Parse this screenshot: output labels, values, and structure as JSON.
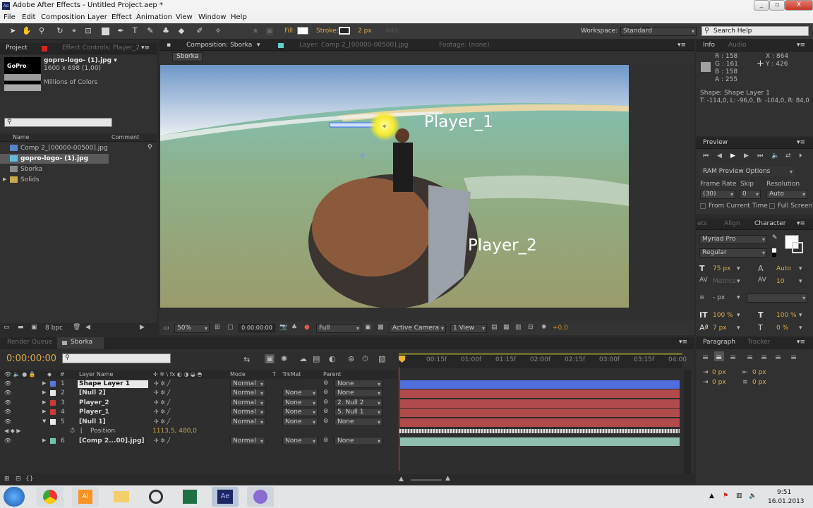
{
  "app": {
    "title": "Adobe After Effects - Untitled Project.aep *",
    "window_buttons": [
      "_",
      "▫",
      "X"
    ]
  },
  "menu": [
    "File",
    "Edit",
    "Composition",
    "Layer",
    "Effect",
    "Animation",
    "View",
    "Window",
    "Help"
  ],
  "toolbar": {
    "fill_label": "Fill:",
    "stroke_label": "Stroke:",
    "stroke_width": "2 px",
    "add_label": "Add:",
    "workspace_label": "Workspace:",
    "workspace_value": "Standard",
    "search_placeholder": "Search Help"
  },
  "project": {
    "tab": "Project",
    "tab2": "Effect Controls: Player_2",
    "file_name": "gopro-logo- (1).jpg ▾",
    "file_dims": "1600 x 698 (1,00)",
    "file_colors": "Millions of Colors",
    "col_name": "Name",
    "col_comment": "Comment",
    "items": [
      "Comp 2_[00000-00500].jpg",
      "gopro-logo- (1).jpg",
      "Sborka",
      "Solids"
    ],
    "bpc": "8 bpc"
  },
  "comp": {
    "tab": "Composition: Sborka",
    "tab_layer": "Layer: Comp 2_[00000-00500].jpg",
    "tab_footage": "Footage: (none)",
    "breadcrumb": "Sborka",
    "text1": "Player_1",
    "text2": "Player_2",
    "zoom": "50%",
    "timecode": "0:00:00:00",
    "quality": "Full",
    "camera": "Active Camera",
    "view": "1 View",
    "exposure": "+0,0"
  },
  "info": {
    "tab": "Info",
    "tab2": "Audio",
    "r": "R : 158",
    "g": "G : 161",
    "b": "B : 158",
    "a": "A : 255",
    "x": "X : 864",
    "y": "Y : 426",
    "shape": "Shape: Shape Layer 1",
    "bounds": "T: -114,0, L: -96,0, B: -104,0, R: 84,0"
  },
  "preview": {
    "tab": "Preview",
    "ram": "RAM Preview Options",
    "frame_rate_label": "Frame Rate",
    "skip_label": "Skip",
    "resolution_label": "Resolution",
    "frame_rate": "(30)",
    "skip": "0",
    "resolution": "Auto",
    "from_current": "From Current Time",
    "full_screen": "Full Screen"
  },
  "character": {
    "tab_effects": "ets",
    "tab_align": "Align",
    "tab_char": "Character",
    "font": "Myriad Pro",
    "style": "Regular",
    "size": "75 px",
    "leading": "Auto",
    "kerning": "Metrics",
    "tracking": "10",
    "indent_unit": "- px",
    "v_scale": "100 %",
    "h_scale": "100 %",
    "baseline": "7 px",
    "tsume": "0 %"
  },
  "paragraph": {
    "tab": "Paragraph",
    "tab2": "Tracker",
    "v1": "0 px",
    "v2": "0 px",
    "v3": "0 px",
    "v4": "0 px",
    "v5": "0 px"
  },
  "timeline": {
    "tab_render": "Render Queue",
    "tab_comp": "Sborka",
    "timecode": "0:00:00:00",
    "col_layer": "Layer Name",
    "col_mode": "Mode",
    "col_t": "T",
    "col_trkmat": "TrkMat",
    "col_parent": "Parent",
    "ruler": [
      "0f",
      "00:15f",
      "01:00f",
      "01:15f",
      "02:00f",
      "02:15f",
      "03:00f",
      "03:15f",
      "04:00"
    ],
    "layers": [
      {
        "num": "1",
        "name": "Shape Layer 1",
        "mode": "Normal",
        "trkmat": "",
        "parent": "None",
        "color": "#5b74d6"
      },
      {
        "num": "2",
        "name": "[Null 2]",
        "mode": "Normal",
        "trkmat": "None",
        "parent": "None",
        "color": "#e8e8e8"
      },
      {
        "num": "3",
        "name": "Player_2",
        "mode": "Normal",
        "trkmat": "None",
        "parent": "2. Null 2",
        "color": "#c93b3b"
      },
      {
        "num": "4",
        "name": "Player_1",
        "mode": "Normal",
        "trkmat": "None",
        "parent": "5. Null 1",
        "color": "#c93b3b"
      },
      {
        "num": "5",
        "name": "[Null 1]",
        "mode": "Normal",
        "trkmat": "None",
        "parent": "None",
        "color": "#e8e8e8"
      },
      {
        "num": "6",
        "name": "[Comp 2...00].jpg]",
        "mode": "Normal",
        "trkmat": "None",
        "parent": "None",
        "color": "#74c2b0"
      }
    ],
    "position_label": "Position",
    "position_value": "1113,5, 480,0"
  },
  "taskbar": {
    "time": "9:51",
    "date": "16.01.2013"
  }
}
